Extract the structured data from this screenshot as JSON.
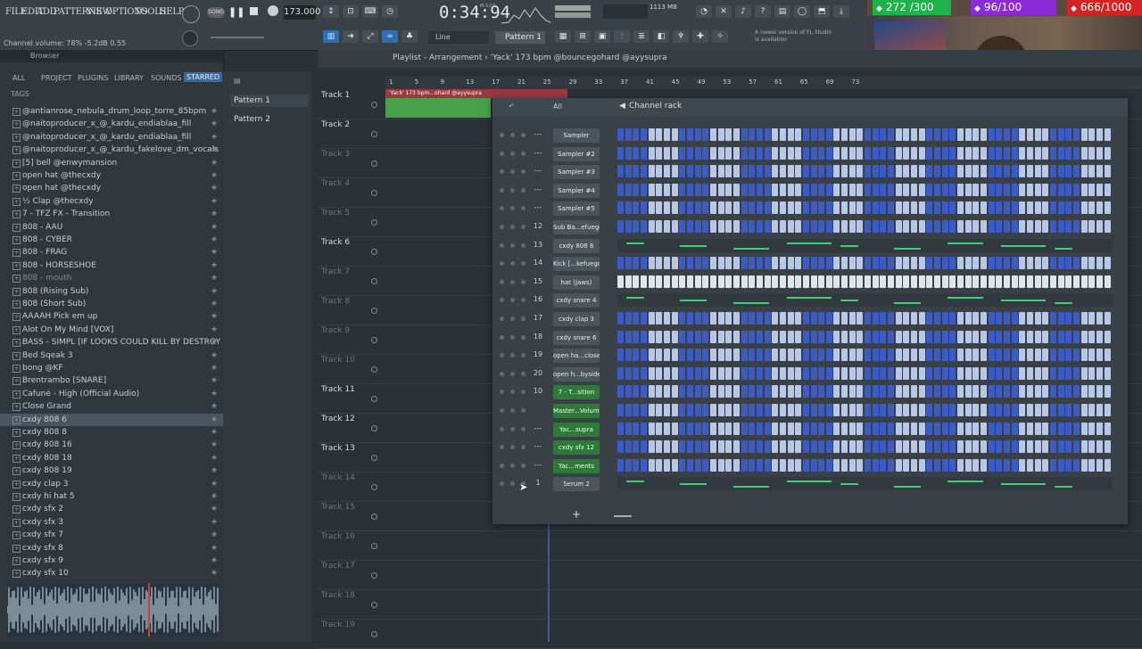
{
  "menu": [
    "FILE",
    "EDIT",
    "ADD",
    "PATTERNS",
    "VIEW",
    "OPTIONS",
    "TOOLS",
    "HELP"
  ],
  "transport": {
    "bpm": "173.000",
    "time": "0:34:94",
    "time_unit": "M:S:CS",
    "cpu_mem": "1113 MB"
  },
  "hint_bar": "Channel volume: 78% -5.2dB 0.55",
  "snap_mode": "Line",
  "pattern_selector": "Pattern 1",
  "update_notice": "A newer version of FL Studio is available!",
  "browser": {
    "title": "Browser",
    "tabs": [
      "ALL",
      "PROJECT",
      "PLUGINS",
      "LIBRARY",
      "SOUNDS",
      "STARRED"
    ],
    "tags_label": "TAGS",
    "items": [
      {
        "label": "@antianrose_nebula_drum_loop_torre_85bpm",
        "dim": false
      },
      {
        "label": "@naitoproducer_x_@_kardu_endiablaa_fill",
        "dim": false
      },
      {
        "label": "@naitoproducer_x_@_kardu_endiablaa_fill",
        "dim": false
      },
      {
        "label": "@naitoproducer_x_@_kardu_fakelove_dm_vocals",
        "dim": false
      },
      {
        "label": "[5] bell @enwymansion",
        "dim": false
      },
      {
        "label": "open hat @thecxdy",
        "dim": false
      },
      {
        "label": "open hat @thecxdy",
        "dim": false
      },
      {
        "label": "½ Clap @thecxdy",
        "dim": false
      },
      {
        "label": "7 - TFZ FX - Transition",
        "dim": false
      },
      {
        "label": "808 - AAU",
        "dim": false
      },
      {
        "label": "808 - CYBER",
        "dim": false
      },
      {
        "label": "808 - FRAG",
        "dim": false
      },
      {
        "label": "808 - HORSESHOE",
        "dim": false
      },
      {
        "label": "808 - mouth",
        "dim": true
      },
      {
        "label": "808 (Rising Sub)",
        "dim": false
      },
      {
        "label": "808 (Short Sub)",
        "dim": false
      },
      {
        "label": "AAAAH Pick em up",
        "dim": false
      },
      {
        "label": "Alot On My Mind [VOX]",
        "dim": false
      },
      {
        "label": "BASS - SIMPL [IF LOOKS COULD KILL BY DESTROY LONELY]",
        "dim": false
      },
      {
        "label": "Bed Sqeak 3",
        "dim": false
      },
      {
        "label": "bong @KF",
        "dim": false
      },
      {
        "label": "Brentrambo [SNARE]",
        "dim": false
      },
      {
        "label": "Cafuné - High (Official Audio)",
        "dim": false
      },
      {
        "label": "Close Grand",
        "dim": false
      },
      {
        "label": "cxdy 808 6",
        "dim": false
      },
      {
        "label": "cxdy 808 8",
        "dim": false
      },
      {
        "label": "cxdy 808 16",
        "dim": false
      },
      {
        "label": "cxdy 808 18",
        "dim": false
      },
      {
        "label": "cxdy 808 19",
        "dim": false
      },
      {
        "label": "cxdy clap 3",
        "dim": false
      },
      {
        "label": "cxdy hi hat 5",
        "dim": false
      },
      {
        "label": "cxdy sfx 2",
        "dim": false
      },
      {
        "label": "cxdy sfx 3",
        "dim": false
      },
      {
        "label": "cxdy sfx 7",
        "dim": false
      },
      {
        "label": "cxdy sfx 8",
        "dim": false
      },
      {
        "label": "cxdy sfx 9",
        "dim": false
      },
      {
        "label": "cxdy sfx 10",
        "dim": false
      }
    ],
    "selected_index": 24
  },
  "patterns": [
    "Pattern 1",
    "Pattern 2"
  ],
  "playlist": {
    "title": "Playlist - Arrangement › 'Yack' 173 bpm @bouncegohard @ayysupra",
    "clip_label": "'Yack' 173 bpm...ohard @ayysupra",
    "ruler": [
      "1",
      "5",
      "9",
      "13",
      "17",
      "21",
      "25",
      "29",
      "33",
      "37",
      "41",
      "45",
      "49",
      "53",
      "57",
      "61",
      "65",
      "69",
      "73"
    ],
    "tracks": [
      {
        "name": "Track 1",
        "dim": false
      },
      {
        "name": "Track 2",
        "dim": false
      },
      {
        "name": "Track 3",
        "dim": true
      },
      {
        "name": "Track 4",
        "dim": true
      },
      {
        "name": "Track 5",
        "dim": true
      },
      {
        "name": "Track 6",
        "dim": false
      },
      {
        "name": "Track 7",
        "dim": true
      },
      {
        "name": "Track 8",
        "dim": true
      },
      {
        "name": "Track 9",
        "dim": true
      },
      {
        "name": "Track 10",
        "dim": true
      },
      {
        "name": "Track 11",
        "dim": false
      },
      {
        "name": "Track 12",
        "dim": false
      },
      {
        "name": "Track 13",
        "dim": false
      },
      {
        "name": "Track 14",
        "dim": true
      },
      {
        "name": "Track 15",
        "dim": true
      },
      {
        "name": "Track 16",
        "dim": true
      },
      {
        "name": "Track 17",
        "dim": true
      },
      {
        "name": "Track 18",
        "dim": true
      },
      {
        "name": "Track 19",
        "dim": true
      }
    ]
  },
  "channel_rack": {
    "title": "Channel rack",
    "filter": "All",
    "channels": [
      {
        "num": "---",
        "name": "Sampler",
        "green": false,
        "type": "steps"
      },
      {
        "num": "---",
        "name": "Sampler #2",
        "green": false,
        "type": "steps"
      },
      {
        "num": "---",
        "name": "Sampler #3",
        "green": false,
        "type": "steps"
      },
      {
        "num": "---",
        "name": "Sampler #4",
        "green": false,
        "type": "steps"
      },
      {
        "num": "---",
        "name": "Sampler #5",
        "green": false,
        "type": "steps"
      },
      {
        "num": "12",
        "name": "Sub Ba...efuego",
        "green": false,
        "type": "steps"
      },
      {
        "num": "13",
        "name": "cxdy 808 6",
        "green": false,
        "type": "roll"
      },
      {
        "num": "14",
        "name": "Kick [...kefuego",
        "green": false,
        "type": "steps"
      },
      {
        "num": "15",
        "name": "hat (Jaws)",
        "green": false,
        "type": "white"
      },
      {
        "num": "16",
        "name": "cxdy snare 4",
        "green": false,
        "type": "roll"
      },
      {
        "num": "17",
        "name": "cxdy clap 3",
        "green": false,
        "type": "steps"
      },
      {
        "num": "18",
        "name": "cxdy snare 6",
        "green": false,
        "type": "steps"
      },
      {
        "num": "19",
        "name": "open ha...close)",
        "green": false,
        "type": "steps"
      },
      {
        "num": "20",
        "name": "open h...byside)",
        "green": false,
        "type": "steps"
      },
      {
        "num": "10",
        "name": "7 - T...sition",
        "green": true,
        "type": "steps"
      },
      {
        "num": "",
        "name": "Master...Volume",
        "green": true,
        "type": "steps"
      },
      {
        "num": "---",
        "name": "Yac...supra",
        "green": true,
        "type": "steps"
      },
      {
        "num": "---",
        "name": "cxdy sfx 12",
        "green": true,
        "type": "steps"
      },
      {
        "num": "---",
        "name": "Yac...ments",
        "green": true,
        "type": "steps"
      },
      {
        "num": "1",
        "name": "Serum 2",
        "green": false,
        "type": "roll"
      }
    ],
    "add_button": "+"
  },
  "stream_stats": [
    {
      "icon": "kick-icon",
      "value": "272 /300",
      "color": "#1fb24a"
    },
    {
      "icon": "heart-icon",
      "value": "96/100",
      "color": "#8b2bd6"
    },
    {
      "icon": "youtube-icon",
      "value": "666/1000",
      "color": "#d42323"
    }
  ]
}
